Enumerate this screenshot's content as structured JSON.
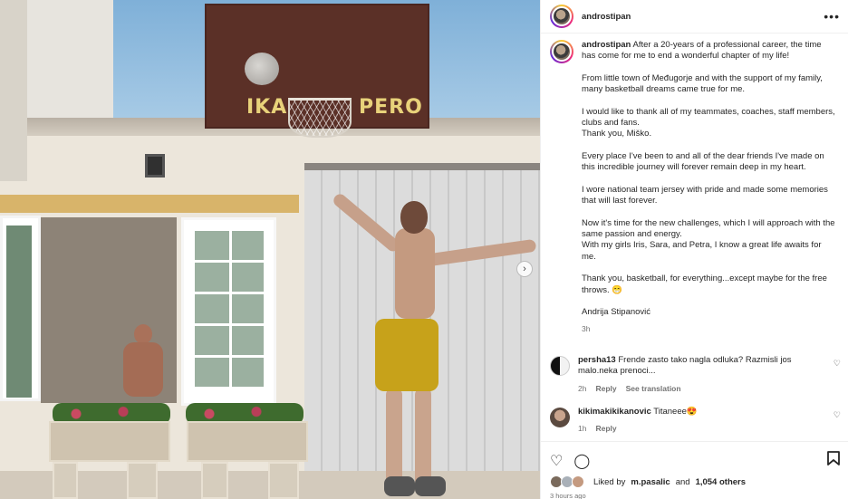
{
  "post": {
    "username": "androstipan",
    "caption_paragraphs": [
      "After a 20-years of a professional career, the time has come for me to end a wonderful chapter of my life!",
      "From little town of Međugorje and with the support of my family, many basketball dreams came true for me.",
      "I would like to thank all of my teammates, coaches, staff members, clubs and fans.",
      "Thank you, Miško.",
      "Every place I've been to and all of the dear friends I've made on this incredible journey will forever remain deep in my heart.",
      "I wore national team jersey with pride and made some memories that will last forever.",
      "Now it's time for the new challenges, which I will approach with the same passion and energy.",
      "With my girls Iris, Sara, and Petra, I know a great life awaits for me.",
      "Thank you, basketball, for everything...except maybe for the free throws. 😁",
      "Andrija Stipanović"
    ],
    "caption_time": "3h",
    "photo_text_left": "IKA",
    "photo_text_right": "PERO"
  },
  "comments": [
    {
      "username": "persha13",
      "text": "Frende zasto tako nagla odluka? Razmisli jos malo.neka prenoci...",
      "time": "2h",
      "reply_label": "Reply",
      "translation_label": "See translation"
    },
    {
      "username": "kikimakikikanovic",
      "text": "Titaneee😍",
      "time": "1h",
      "reply_label": "Reply"
    }
  ],
  "likes": {
    "prefix": "Liked by",
    "user": "m.pasalic",
    "connector": "and",
    "others": "1,054 others"
  },
  "post_time": "3 hours ago",
  "icons": {
    "more": "more-icon",
    "like": "heart-icon",
    "comment": "comment-icon",
    "save": "bookmark-icon",
    "next": "chevron-right-icon"
  }
}
